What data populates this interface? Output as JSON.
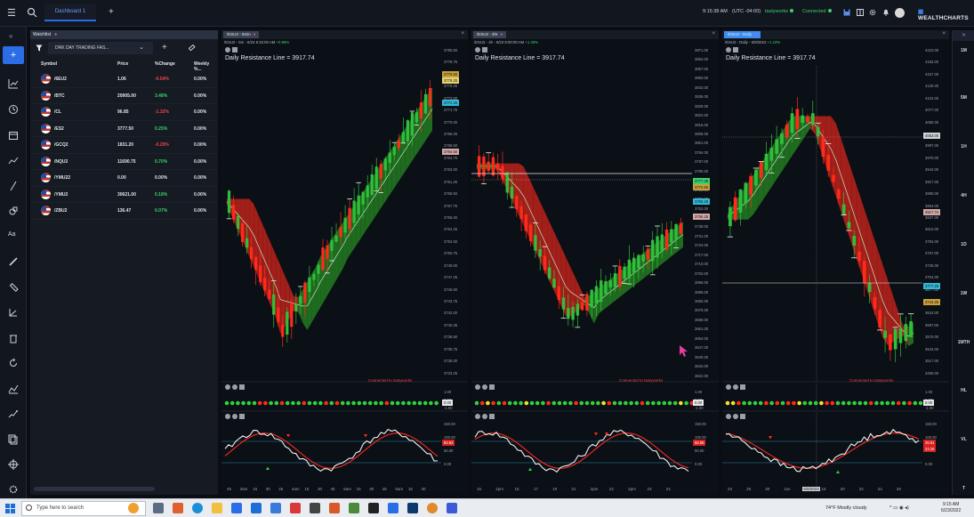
{
  "topbar": {
    "tab_label": "Dashboard 1",
    "time": "9:15:38 AM",
    "timezone": "(UTC -04:00)",
    "broker": "tastyworks",
    "connection": "Connected",
    "logo": "WEALTHCHARTS"
  },
  "watchlist": {
    "header": "Watchlist",
    "list_name": "DRK DAY TRADING FAS...",
    "columns": [
      "Symbol",
      "Price",
      "%Change",
      "Weekly %..."
    ],
    "rows": [
      {
        "symbol": "/6EU2",
        "price": "1.06",
        "change": "-0.54%",
        "weekly": "0.00%",
        "dir": "down"
      },
      {
        "symbol": "/BTC",
        "price": "20905.00",
        "change": "3.48%",
        "weekly": "0.00%",
        "dir": "up"
      },
      {
        "symbol": "/CL",
        "price": "96.85",
        "change": "-1.32%",
        "weekly": "0.00%",
        "dir": "down"
      },
      {
        "symbol": "/ES2",
        "price": "3777.50",
        "change": "0.25%",
        "weekly": "0.00%",
        "dir": "up"
      },
      {
        "symbol": "/GCQ2",
        "price": "1831.20",
        "change": "-0.29%",
        "weekly": "0.00%",
        "dir": "down"
      },
      {
        "symbol": "/NQU2",
        "price": "11690.75",
        "change": "0.70%",
        "weekly": "0.00%",
        "dir": "up"
      },
      {
        "symbol": "/YMU22",
        "price": "0.00",
        "change": "0.00%",
        "weekly": "0.00%",
        "dir": "flat"
      },
      {
        "symbol": "/YMU2",
        "price": "30621.00",
        "change": "0.18%",
        "weekly": "0.00%",
        "dir": "up"
      },
      {
        "symbol": "/ZBU2",
        "price": "136.47",
        "change": "0.07%",
        "weekly": "0.00%",
        "dir": "up"
      }
    ]
  },
  "panels": [
    {
      "tab": "/ESU2 - 5min",
      "info": "/ESU2 - 5m - 6/23 9:15:00 AM",
      "change": "+0.99%",
      "drl": "Daily Resistance Line = 3917.74",
      "connected": "Connected to tastyworks",
      "yticks": [
        "3780.50",
        "3778.75",
        "3777.00",
        "3775.25",
        "3773.50",
        "3771.75",
        "3770.00",
        "3768.25",
        "3766.50",
        "3764.75",
        "3763.00",
        "3761.25",
        "3759.50",
        "3757.75",
        "3756.00",
        "3754.25",
        "3752.50",
        "3750.75",
        "3749.00",
        "3747.25",
        "3745.50",
        "3743.75",
        "3742.00",
        "3740.25",
        "3738.50",
        "3736.75",
        "3735.00",
        "3733.25"
      ],
      "xticks": [
        "45",
        "3am",
        "15",
        "30",
        "45",
        "4am",
        "15",
        "30",
        "45",
        "5am",
        "15",
        "30",
        "45",
        "6am",
        "15",
        "30"
      ],
      "tags": [
        {
          "label": "3779.50",
          "color": "#c8a03a"
        },
        {
          "label": "3779.25",
          "color": "#e6d370"
        },
        {
          "label": "3772.25",
          "color": "#33b8d8"
        },
        {
          "label": "3764.50",
          "color": "#d4a8a8"
        }
      ],
      "osc_ticks": [
        "150.00",
        "100.00",
        "50.00",
        "0.00"
      ],
      "osc_tag": "83.83",
      "dot_ticks": [
        "1.00",
        "0.00",
        "-1.00"
      ],
      "dot_tag": "0.00"
    },
    {
      "tab": "/ESU2 - 4hr",
      "info": "/ESU2 - 4h - 6/23 8:00:00 AM",
      "change": "+1.48%",
      "drl": "Daily Resistance Line = 3917.74",
      "connected": "Connected to tastyworks",
      "yticks": [
        "3871.00",
        "3864.00",
        "3857.00",
        "3850.00",
        "3843.00",
        "3836.00",
        "3829.00",
        "3822.00",
        "3815.00",
        "3808.00",
        "3801.00",
        "3794.00",
        "3787.00",
        "3780.00",
        "3773.00",
        "3766.00",
        "3759.00",
        "3752.00",
        "3745.00",
        "3738.00",
        "3731.00",
        "3724.00",
        "3717.00",
        "3710.00",
        "3703.00",
        "3696.00",
        "3689.00",
        "3682.00",
        "3675.00",
        "3668.00",
        "3661.00",
        "3654.00",
        "3647.00",
        "3640.00",
        "3633.00",
        "3622.00"
      ],
      "xticks": [
        "15",
        "2pm",
        "16",
        "17",
        "19",
        "21",
        "2pm",
        "22",
        "2pm",
        "23",
        "24"
      ],
      "tags": [
        {
          "label": "3777.25",
          "color": "#3bd16f"
        },
        {
          "label": "3772.50",
          "color": "#c8a03a"
        },
        {
          "label": "3766.25",
          "color": "#33b8d8"
        },
        {
          "label": "3755.25",
          "color": "#d4a8a8"
        }
      ],
      "osc_ticks": [
        "150.00",
        "100.00",
        "50.00",
        "0.00"
      ],
      "osc_tag": "68.69",
      "dot_ticks": [
        "1.00",
        "0.00",
        "-1.00"
      ],
      "dot_tag": "0.00"
    },
    {
      "tab": "/ESU2 - Daily",
      "info": "/ESU2 - Daily - 6/8/2022",
      "change": "+1.10%",
      "drl": "Daily Resistance Line = 3917.74",
      "connected": "Connected to tastyworks",
      "yticks": [
        "4210.00",
        "4183.00",
        "4157.00",
        "4130.00",
        "4104.00",
        "4077.00",
        "4050.00",
        "4024.00",
        "3997.00",
        "3970.00",
        "3944.00",
        "3917.00",
        "3890.00",
        "3864.00",
        "3837.00",
        "3810.00",
        "3784.00",
        "3757.00",
        "3730.00",
        "3704.00",
        "3677.00",
        "3650.00",
        "3624.00",
        "3597.00",
        "3570.00",
        "3544.00",
        "3517.00",
        "3490.00"
      ],
      "xticks": [
        "23",
        "25",
        "30",
        "Jun",
        "6/8/2022",
        "15",
        "20",
        "22",
        "24",
        "26"
      ],
      "tags": [
        {
          "label": "4053.00",
          "color": "#cfd3da"
        },
        {
          "label": "3917.74",
          "color": "#d4a8a8"
        },
        {
          "label": "3777.25",
          "color": "#33b8d8"
        },
        {
          "label": "3744.25",
          "color": "#c8a03a"
        }
      ],
      "osc_ticks": [
        "150.00",
        "100.00",
        "50.00",
        "0.00"
      ],
      "osc_tag": "25.81",
      "osc_tag2": "23.26",
      "dot_ticks": [
        "1.00",
        "0.00",
        "-1.00"
      ],
      "dot_tag": "0.00"
    }
  ],
  "rightrail": {
    "items": [
      "1M",
      "5M",
      "1H",
      "4H",
      "1D",
      "1W",
      "1MTH",
      "HL",
      "VL",
      "T"
    ]
  },
  "taskbar": {
    "search_placeholder": "Type here to search",
    "weather": "74°F  Mostly cloudy",
    "time": "9:15 AM",
    "date": "6/23/2022"
  },
  "colors": {
    "accent": "#2a6de6",
    "up": "#3bd16f",
    "down": "#f0454b",
    "cloud_bull": "#1f6b1f",
    "cloud_bear": "#a21f1a"
  }
}
